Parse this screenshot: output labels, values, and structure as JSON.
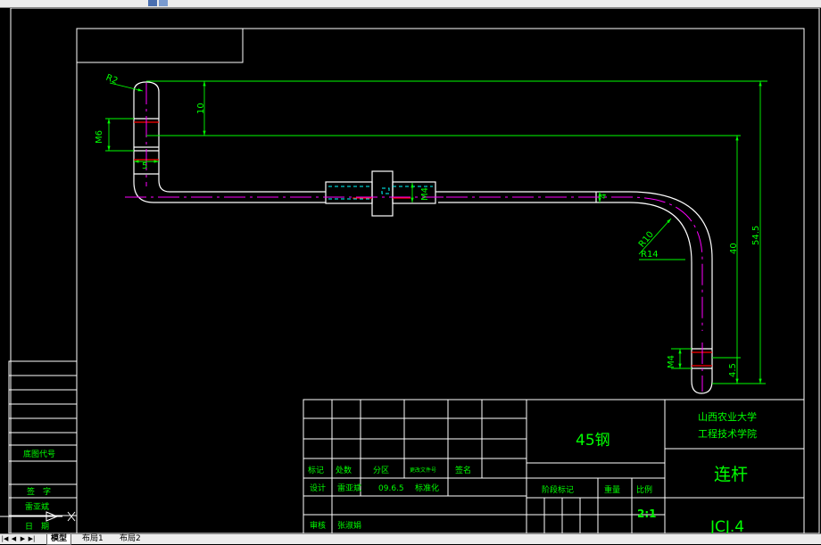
{
  "colors": {
    "background": "#000000",
    "outline": "#ffffff",
    "dimension": "#00ff00",
    "centerline": "#ff00ff",
    "hidden_line": "#00ffff",
    "thread": "#ff0000",
    "title_text": "#00ff00"
  },
  "drawing": {
    "dimensions": {
      "r2": "R2",
      "d10": "10",
      "m6": "M6",
      "d5": "5",
      "m4a": "M4",
      "d4": "4",
      "r10": "R10",
      "r14": "R14",
      "d40": "40",
      "d545": "54.5",
      "m4b": "M4",
      "d45": "4.5"
    }
  },
  "title_block": {
    "material": "45钢",
    "school_line1": "山西农业大学",
    "school_line2": "工程技术学院",
    "part_name": "连杆",
    "drawing_no": "JCJ.4",
    "scale": "2:1",
    "labels": {
      "mark": "标记",
      "count": "处数",
      "zone": "分区",
      "doc_no": "更改文件号",
      "sign": "签名",
      "design": "设计",
      "standardize": "标准化",
      "stage": "阶段标记",
      "weight": "重量",
      "ratio": "比例",
      "review": "审核"
    },
    "designer": "雷亚斌",
    "date": "09.6.5",
    "reviewer": "张淑娟"
  },
  "side_block": {
    "base_code": "底图代号",
    "sign": "签　字",
    "signer": "雷亚斌",
    "date": "日　期"
  },
  "tabs": {
    "model": "模型",
    "layout1": "布局1",
    "layout2": "布局2"
  }
}
